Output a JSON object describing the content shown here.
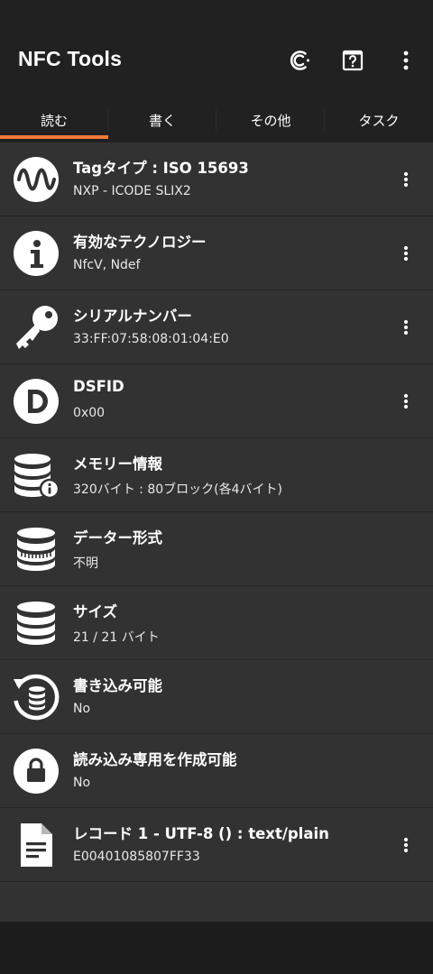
{
  "app": {
    "title": "NFC Tools"
  },
  "actions": [
    {
      "icon": "nfc-c-icon"
    },
    {
      "icon": "help-icon"
    },
    {
      "icon": "more-vert-icon"
    }
  ],
  "tabs": [
    {
      "label": "読む",
      "active": true
    },
    {
      "label": "書く"
    },
    {
      "label": "その他"
    },
    {
      "label": "タスク"
    }
  ],
  "rows": [
    {
      "icon": "waveform-icon",
      "title": "Tagタイプ : ISO 15693",
      "subtitle": "NXP - ICODE SLIX2",
      "has_menu": true
    },
    {
      "icon": "info-icon",
      "title": "有効なテクノロジー",
      "subtitle": "NfcV, Ndef",
      "has_menu": true
    },
    {
      "icon": "key-icon",
      "title": "シリアルナンバー",
      "subtitle": "33:FF:07:58:08:01:04:E0",
      "has_menu": true
    },
    {
      "icon": "d-letter-icon",
      "title": "DSFID",
      "subtitle": "0x00",
      "has_menu": true
    },
    {
      "icon": "database-info-icon",
      "title": "メモリー情報",
      "subtitle": "320バイト : 80ブロック(各4バイト)",
      "has_menu": false
    },
    {
      "icon": "database-format-icon",
      "title": "データー形式",
      "subtitle": "不明",
      "has_menu": false
    },
    {
      "icon": "database-icon",
      "title": "サイズ",
      "subtitle": "21 / 21 バイト",
      "has_menu": false
    },
    {
      "icon": "database-refresh-icon",
      "title": "書き込み可能",
      "subtitle": "No",
      "has_menu": false
    },
    {
      "icon": "lock-icon",
      "title": "読み込み専用を作成可能",
      "subtitle": "No",
      "has_menu": false
    },
    {
      "icon": "document-icon",
      "title": "レコード 1 - UTF-8 () : text/plain",
      "subtitle": "E00401085807FF33",
      "has_menu": true
    }
  ],
  "colors": {
    "accent": "#f07a3c",
    "toolbar": "#212121",
    "list_background": "#323232",
    "bottom_bar": "#1c1c1c"
  }
}
